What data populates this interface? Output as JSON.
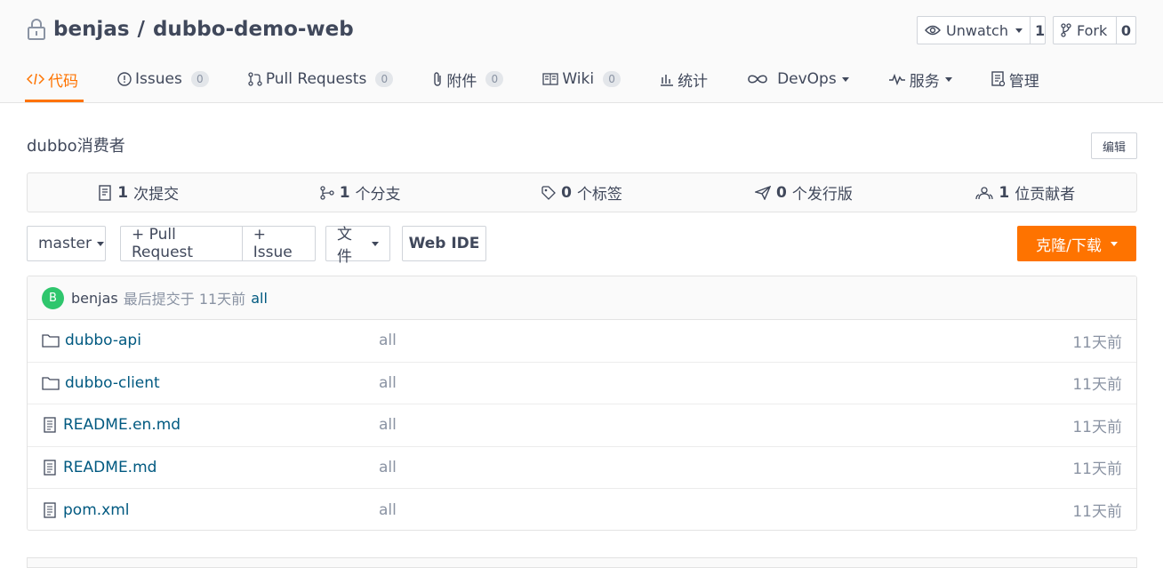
{
  "repo": {
    "owner": "benjas",
    "sep": "/",
    "name": "dubbo-demo-web"
  },
  "watch": {
    "label": "Unwatch",
    "count": "1"
  },
  "fork": {
    "label": "Fork",
    "count": "0"
  },
  "tabs": [
    {
      "label": "代码",
      "icon": "code-icon"
    },
    {
      "label": "Issues",
      "badge": "0",
      "icon": "issue-icon"
    },
    {
      "label": "Pull Requests",
      "badge": "0",
      "icon": "pull-request-icon"
    },
    {
      "label": "附件",
      "badge": "0",
      "icon": "paperclip-icon"
    },
    {
      "label": "Wiki",
      "badge": "0",
      "icon": "book-icon"
    },
    {
      "label": "统计",
      "icon": "bar-chart-icon"
    },
    {
      "label": "DevOps",
      "icon": "infinity-icon"
    },
    {
      "label": "服务",
      "icon": "pulse-icon"
    },
    {
      "label": "管理",
      "icon": "settings-doc-icon"
    }
  ],
  "description": "dubbo消费者",
  "edit_label": "编辑",
  "stats": [
    {
      "count": "1",
      "label": "次提交",
      "icon": "commit-icon"
    },
    {
      "count": "1",
      "label": "个分支",
      "icon": "branch-icon"
    },
    {
      "count": "0",
      "label": "个标签",
      "icon": "tag-icon"
    },
    {
      "count": "0",
      "label": "个发行版",
      "icon": "release-icon"
    },
    {
      "count": "1",
      "label": "位贡献者",
      "icon": "contributors-icon"
    }
  ],
  "toolbar": {
    "branch": "master",
    "pull_request": "+ Pull Request",
    "issue": "+ Issue",
    "file": "文件",
    "web_ide": "Web IDE",
    "clone": "克隆/下载"
  },
  "last_commit": {
    "avatar": "B",
    "user": "benjas",
    "text": "最后提交于 11天前",
    "message": "all"
  },
  "files": [
    {
      "name": "dubbo-api",
      "type": "folder",
      "message": "all",
      "time": "11天前"
    },
    {
      "name": "dubbo-client",
      "type": "folder",
      "message": "all",
      "time": "11天前"
    },
    {
      "name": "README.en.md",
      "type": "file",
      "message": "all",
      "time": "11天前"
    },
    {
      "name": "README.md",
      "type": "file",
      "message": "all",
      "time": "11天前"
    },
    {
      "name": "pom.xml",
      "type": "file",
      "message": "all",
      "time": "11天前"
    }
  ],
  "colors": {
    "accent": "#fe7300",
    "link": "#005980",
    "text": "#40485b",
    "muted": "#8a93a3",
    "avatar": "#2fc66d"
  }
}
